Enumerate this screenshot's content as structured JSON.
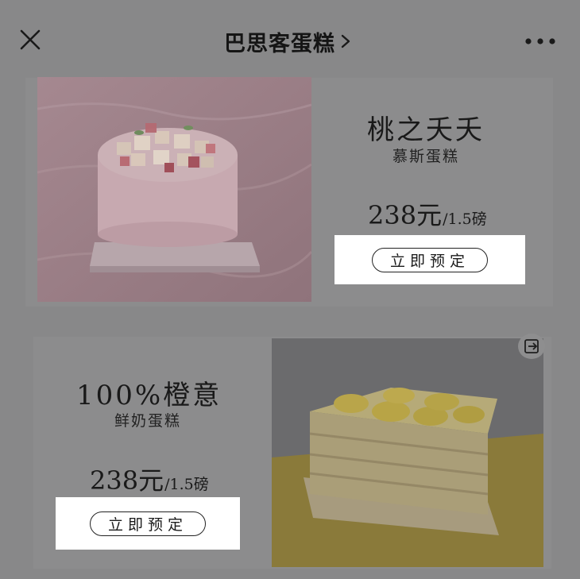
{
  "header": {
    "title": "巴思客蛋糕",
    "close_icon": "close-icon",
    "chevron_icon": "chevron-right-icon",
    "more_icon": "more-horizontal-icon"
  },
  "products": [
    {
      "name": "桃之夭夭",
      "subtitle": "慕斯蛋糕",
      "price": "238元",
      "unit": "/1.5磅",
      "button_label": "立即预定"
    },
    {
      "name": "100%橙意",
      "subtitle": "鲜奶蛋糕",
      "price": "238元",
      "unit": "/1.5磅",
      "button_label": "立即预定"
    }
  ],
  "share_icon": "share-exit-icon",
  "colors": {
    "overlay_background": "#888889",
    "button_highlight": "#ffffff",
    "text_dark": "#1b1b1b"
  }
}
